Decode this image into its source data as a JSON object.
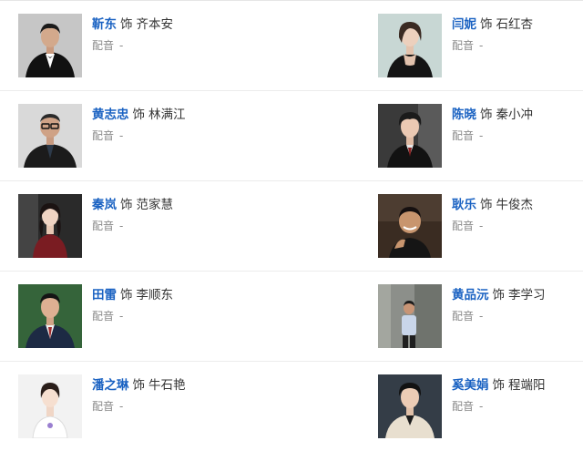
{
  "cast": [
    {
      "actor": "靳东",
      "as": "饰",
      "role": "齐本安",
      "voice_label": "配音",
      "voice_value": "-"
    },
    {
      "actor": "闫妮",
      "as": "饰",
      "role": "石红杏",
      "voice_label": "配音",
      "voice_value": "-"
    },
    {
      "actor": "黄志忠",
      "as": "饰",
      "role": "林满江",
      "voice_label": "配音",
      "voice_value": "-"
    },
    {
      "actor": "陈晓",
      "as": "饰",
      "role": "秦小冲",
      "voice_label": "配音",
      "voice_value": "-"
    },
    {
      "actor": "秦岚",
      "as": "饰",
      "role": "范家慧",
      "voice_label": "配音",
      "voice_value": "-"
    },
    {
      "actor": "耿乐",
      "as": "饰",
      "role": "牛俊杰",
      "voice_label": "配音",
      "voice_value": "-"
    },
    {
      "actor": "田雷",
      "as": "饰",
      "role": "李顺东",
      "voice_label": "配音",
      "voice_value": "-"
    },
    {
      "actor": "黄品沅",
      "as": "饰",
      "role": "李学习",
      "voice_label": "配音",
      "voice_value": "-"
    },
    {
      "actor": "潘之琳",
      "as": "饰",
      "role": "牛石艳",
      "voice_label": "配音",
      "voice_value": "-"
    },
    {
      "actor": "奚美娟",
      "as": "饰",
      "role": "程端阳",
      "voice_label": "配音",
      "voice_value": "-"
    }
  ],
  "colors": {
    "actor_link": "#1a62c2",
    "text": "#333333",
    "muted": "#8a8a8a",
    "divider": "#ececec"
  }
}
